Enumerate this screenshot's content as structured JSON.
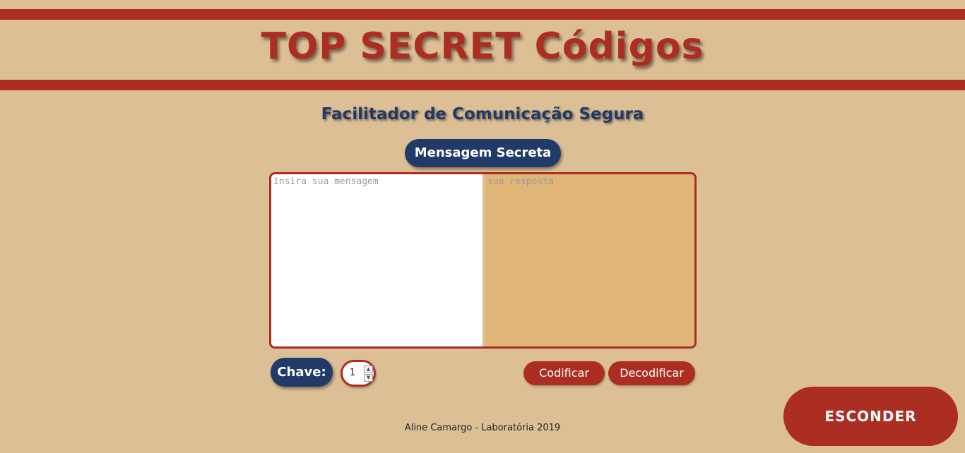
{
  "header": {
    "title": "TOP SECRET Códigos"
  },
  "subtitle": "Facilitador de Comunicação Segura",
  "section_label": "Mensagem Secreta",
  "editor": {
    "input_placeholder": "insira sua mensagem",
    "input_value": "",
    "output_placeholder": "sua resposta",
    "output_value": ""
  },
  "key": {
    "label": "Chave:",
    "value": "1"
  },
  "actions": {
    "encode_label": "Codificar",
    "decode_label": "Decodificar"
  },
  "footer": "Aline Camargo - Laboratória 2019",
  "hide_button": "ESCONDER",
  "colors": {
    "background": "#dcbf95",
    "accent_red": "#ac2e22",
    "navy": "#223a67",
    "output_bg": "#e0b678"
  }
}
